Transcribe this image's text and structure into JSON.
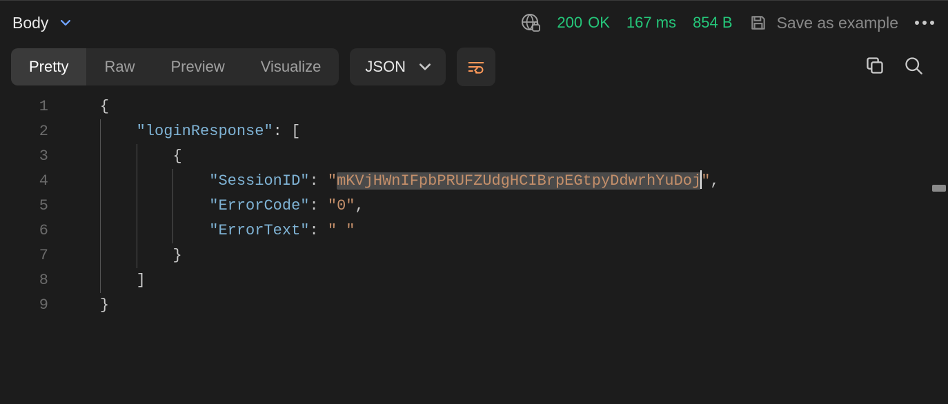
{
  "header": {
    "body_label": "Body",
    "status_code": "200",
    "status_text": "OK",
    "time": "167 ms",
    "size": "854 B",
    "save_label": "Save as example"
  },
  "tabs": {
    "items": [
      {
        "label": "Pretty",
        "active": true
      },
      {
        "label": "Raw",
        "active": false
      },
      {
        "label": "Preview",
        "active": false
      },
      {
        "label": "Visualize",
        "active": false
      }
    ],
    "format": "JSON"
  },
  "code": {
    "lines": [
      "1",
      "2",
      "3",
      "4",
      "5",
      "6",
      "7",
      "8",
      "9"
    ],
    "l1_open": "{",
    "l2_key": "\"loginResponse\"",
    "l2_after": ": [",
    "l3_open": "{",
    "l4_key": "\"SessionID\"",
    "l4_colon": ": ",
    "l4_q1": "\"",
    "l4_val": "mKVjHWnIFpbPRUFZUdgHCIBrpEGtpyDdwrhYuDoj",
    "l4_q2": "\"",
    "l4_end": ",",
    "l5_key": "\"ErrorCode\"",
    "l5_colon": ": ",
    "l5_val": "\"0\"",
    "l5_end": ",",
    "l6_key": "\"ErrorText\"",
    "l6_colon": ": ",
    "l6_val": "\" \"",
    "l7_close": "}",
    "l8_close": "]",
    "l9_close": "}"
  }
}
